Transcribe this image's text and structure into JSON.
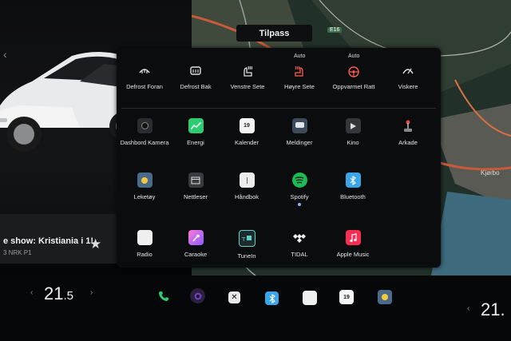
{
  "launcher": {
    "title": "Tilpass",
    "quick_controls": [
      {
        "label": "Defrost Foran",
        "icon": "defrost-front-icon"
      },
      {
        "label": "Defrost Bak",
        "icon": "defrost-rear-icon"
      },
      {
        "label": "Venstre Sete",
        "icon": "seat-heater-left-icon"
      },
      {
        "label": "Høyre Sete",
        "icon": "seat-heater-right-icon",
        "badge": "Auto"
      },
      {
        "label": "Oppvarmet Ratt",
        "icon": "heated-steering-wheel-icon",
        "badge": "Auto"
      },
      {
        "label": "Viskere",
        "icon": "wipers-icon"
      }
    ],
    "apps": [
      {
        "label": "Dashbord Kamera",
        "icon": "dashcam-icon"
      },
      {
        "label": "Energi",
        "icon": "energy-chart-icon"
      },
      {
        "label": "Kalender",
        "icon": "calendar-icon",
        "value": "19"
      },
      {
        "label": "Meldinger",
        "icon": "messages-icon"
      },
      {
        "label": "Kino",
        "icon": "theater-icon"
      },
      {
        "label": "Arkade",
        "icon": "joystick-icon"
      },
      {
        "label": "Leketøy",
        "icon": "toybox-icon"
      },
      {
        "label": "Nettleser",
        "icon": "browser-icon"
      },
      {
        "label": "Håndbok",
        "icon": "manual-icon"
      },
      {
        "label": "Spotify",
        "icon": "spotify-icon"
      },
      {
        "label": "Bluetooth",
        "icon": "bluetooth-icon"
      },
      {
        "label": "Radio",
        "icon": "radio-icon"
      },
      {
        "label": "Caraoke",
        "icon": "caraoke-icon"
      },
      {
        "label": "TuneIn",
        "icon": "tunein-icon"
      },
      {
        "label": "TIDAL",
        "icon": "tidal-icon"
      },
      {
        "label": "Apple Music",
        "icon": "apple-music-icon"
      }
    ]
  },
  "media": {
    "title": "e show: Kristiania i 1!",
    "subtitle": "3 NRK P1"
  },
  "map": {
    "road": "E16",
    "place": "Kjørbo"
  },
  "climate": {
    "driver_temp": "21",
    "driver_temp_decimal": ".5",
    "passenger_temp": "21."
  },
  "dock": {
    "calendar_day": "19"
  },
  "colors": {
    "accent": "#3b82f6",
    "panel": "#0b0c0e",
    "energy": "#2ecc71",
    "spotify": "#1db954",
    "apple_music": "#fa2d55"
  }
}
